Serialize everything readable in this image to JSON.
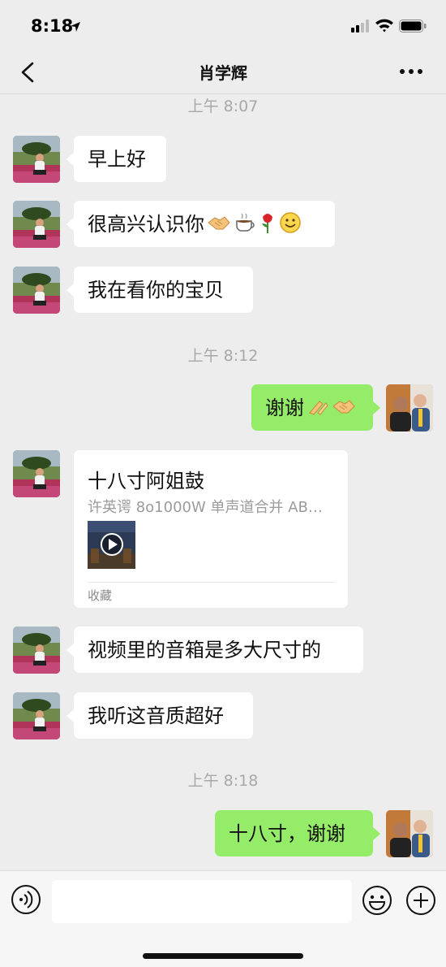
{
  "status_bar": {
    "time": "8:18"
  },
  "nav": {
    "title": "肖学辉"
  },
  "messages": [
    {
      "type": "timestamp",
      "text": "上午 8:07"
    },
    {
      "type": "text",
      "side": "left",
      "text": "早上好"
    },
    {
      "type": "text",
      "side": "left",
      "text": "很高兴认识你",
      "emojis": [
        "handshake",
        "coffee",
        "rose",
        "smile"
      ]
    },
    {
      "type": "text",
      "side": "left",
      "text": "我在看你的宝贝"
    },
    {
      "type": "timestamp",
      "text": "上午 8:12"
    },
    {
      "type": "text",
      "side": "right",
      "text": "谢谢",
      "emojis": [
        "clap",
        "handshake"
      ]
    },
    {
      "type": "card",
      "side": "left",
      "title": "十八寸阿姐鼓",
      "description": "许英谔 8o1000W 单声道合并 AB…",
      "footer": "收藏"
    },
    {
      "type": "text",
      "side": "left",
      "text": "视频里的音箱是多大尺寸的"
    },
    {
      "type": "text",
      "side": "left",
      "text": "我听这音质超好"
    },
    {
      "type": "timestamp",
      "text": "上午 8:18"
    },
    {
      "type": "text",
      "side": "right",
      "text": "十八寸，谢谢"
    }
  ],
  "input": {
    "placeholder": ""
  },
  "colors": {
    "background": "#ededed",
    "right_bubble": "#95ec69",
    "left_bubble": "#ffffff",
    "timestamp": "#a8a8a8"
  },
  "icons": [
    "location-arrow-icon",
    "signal-icon",
    "wifi-icon",
    "battery-icon",
    "back-icon",
    "more-icon",
    "voice-icon",
    "emoji-icon",
    "plus-icon",
    "play-icon"
  ]
}
